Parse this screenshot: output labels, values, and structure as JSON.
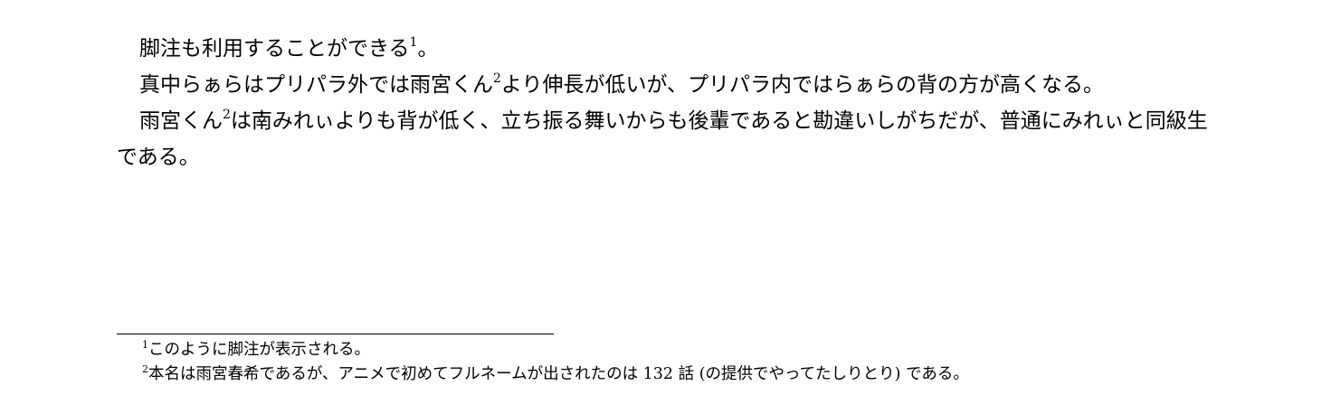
{
  "paragraphs": [
    {
      "text": "脚注も利用することができる",
      "mark": "1",
      "tail": "。"
    },
    {
      "before": "真中らぁらはプリパラ外では雨宮くん",
      "mark": "2",
      "after": "より伸長が低いが、プリパラ内ではらぁらの背の方が高くなる。"
    },
    {
      "before": "雨宮くん",
      "mark": "2",
      "after": "は南みれぃよりも背が低く、立ち振る舞いからも後輩であると勘違いしがちだが、普通にみれぃと同級生である。"
    }
  ],
  "footnotes": [
    {
      "mark": "1",
      "text": "このように脚注が表示される。"
    },
    {
      "mark": "2",
      "text": "本名は雨宮春希であるが、アニメで初めてフルネームが出されたのは 132 話 (の提供でやってたしりとり) である。"
    }
  ]
}
